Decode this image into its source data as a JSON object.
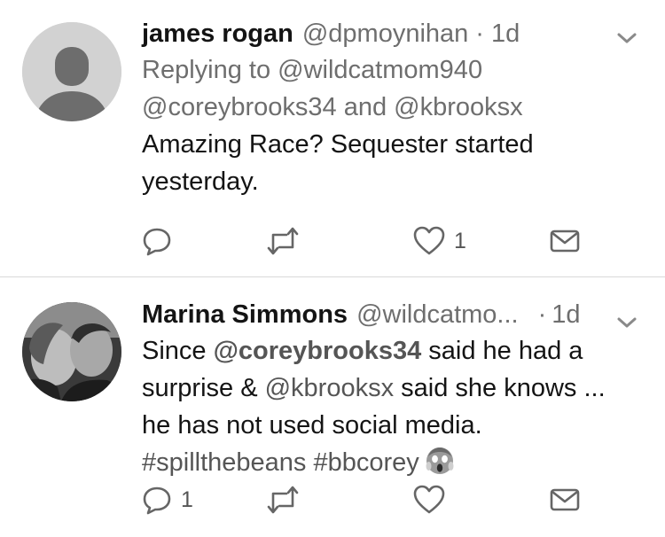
{
  "tweets": [
    {
      "name": "james rogan",
      "handle": "@dpmoynihan",
      "dot": "·",
      "time": "1d",
      "replying_prefix": "Replying to",
      "replying_to_1": "@wildcatmom940",
      "replying_to_2": "@coreybrooks34",
      "replying_and": "and",
      "replying_to_3": "@kbrooksx",
      "text_line_1": "Amazing Race?  Sequester started",
      "text_line_2": "yesterday.",
      "reply_count": "",
      "retweet_count": "",
      "like_count": "1"
    },
    {
      "name": "Marina Simmons",
      "handle": "@wildcatmo...",
      "dot": "·",
      "time": "1d",
      "text_1": "Since ",
      "mention_1": "@coreybrooks34",
      "text_2": " said he had a",
      "text_3": "surprise & ",
      "mention_2": "@kbrooksx",
      "text_4": " said she knows ...",
      "text_5": "he has not used social media.",
      "hashtag_1": "#spillthebeans",
      "hashtag_2": "#bbcorey",
      "reply_count": "1",
      "retweet_count": "",
      "like_count": ""
    }
  ],
  "icons": {
    "reply": "reply-icon",
    "retweet": "retweet-icon",
    "like": "heart-icon",
    "dm": "envelope-icon",
    "more": "chevron-down-icon",
    "emoji": "screaming-face-emoji"
  }
}
